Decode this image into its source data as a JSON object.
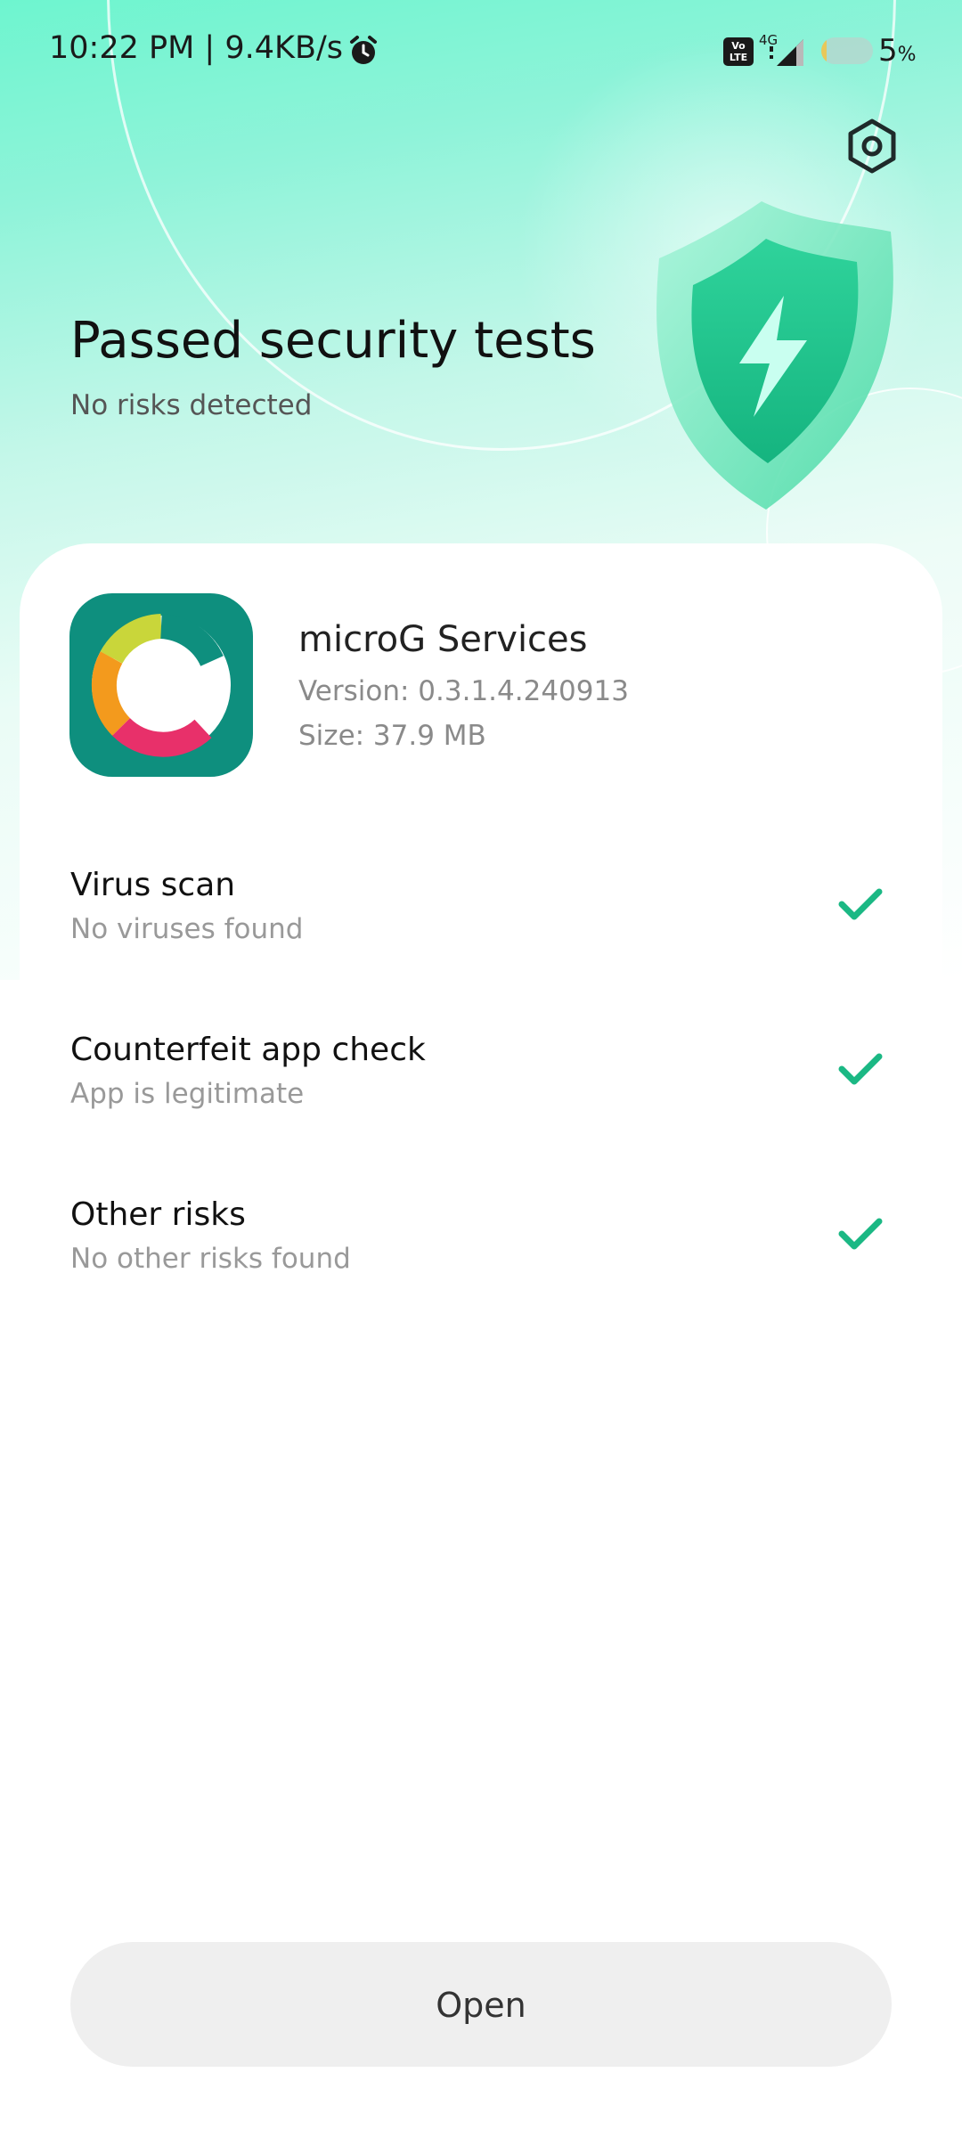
{
  "status_bar": {
    "time": "10:22 PM | 9.4KB/s",
    "network_type": "4G",
    "volte_label_top": "Vo",
    "volte_label_bottom": "LTE",
    "battery_percent": "5",
    "battery_unit": "%",
    "battery_level": 0.05
  },
  "header": {
    "title": "Passed security tests",
    "subtitle": "No risks detected"
  },
  "app": {
    "name": "microG Services",
    "version": "Version: 0.3.1.4.240913",
    "size": "Size: 37.9 MB"
  },
  "checks": [
    {
      "title": "Virus scan",
      "description": "No viruses found",
      "status_icon": "checkmark-icon"
    },
    {
      "title": "Counterfeit app check",
      "description": "App is legitimate",
      "status_icon": "checkmark-icon"
    },
    {
      "title": "Other risks",
      "description": "No other risks found",
      "status_icon": "checkmark-icon"
    }
  ],
  "actions": {
    "open_label": "Open"
  },
  "colors": {
    "accent": "#1bb884",
    "app_icon_bg": "#0e8f7e",
    "button_bg": "#efefef"
  }
}
